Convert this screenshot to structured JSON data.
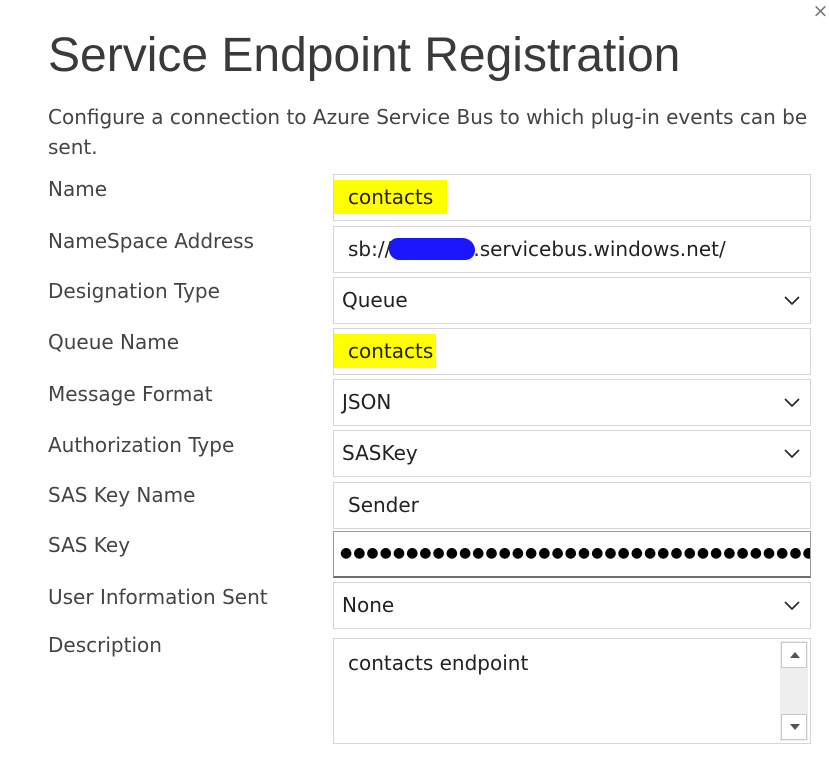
{
  "dialog": {
    "title": "Service Endpoint Registration",
    "description": "Configure a connection to Azure Service Bus to which plug-in events can be sent.",
    "close_glyph": "×"
  },
  "fields": {
    "name": {
      "label": "Name",
      "value": "contacts"
    },
    "namespace_address": {
      "label": "NameSpace Address",
      "value_prefix": "sb://",
      "value_suffix": ".servicebus.windows.net/"
    },
    "designation_type": {
      "label": "Designation Type",
      "value": "Queue"
    },
    "queue_name": {
      "label": "Queue Name",
      "value": "contacts"
    },
    "message_format": {
      "label": "Message Format",
      "value": "JSON"
    },
    "authorization_type": {
      "label": "Authorization Type",
      "value": "SASKey"
    },
    "sas_key_name": {
      "label": "SAS Key Name",
      "value": "Sender"
    },
    "sas_key": {
      "label": "SAS Key",
      "value": "●●●●●●●●●●●●●●●●●●●●●●●●●●●●●●●●●●●●●●"
    },
    "user_information_sent": {
      "label": "User Information Sent",
      "value": "None"
    },
    "description": {
      "label": "Description",
      "value": "contacts endpoint"
    }
  },
  "icons": {
    "close": "close-icon",
    "dropdown": "chevron-down-icon",
    "scroll_up": "triangle-up-icon",
    "scroll_down": "triangle-down-icon"
  },
  "colors": {
    "highlight": "#ffff00",
    "redaction": "#1a17ff",
    "border": "#d6d6d6",
    "text": "#444444"
  }
}
